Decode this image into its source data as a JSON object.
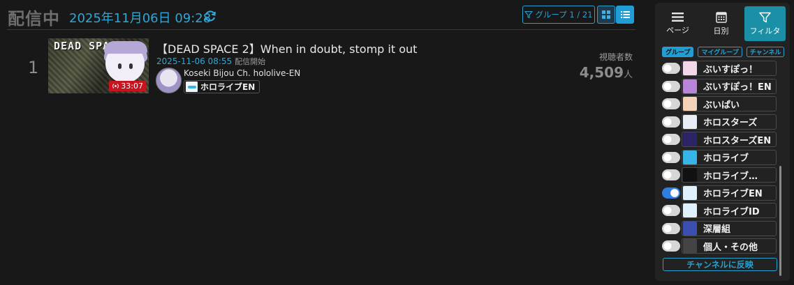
{
  "header": {
    "title": "配信中",
    "datetime": "2025年11月06日 09:28",
    "group_filter_label": "グループ 1 / 21"
  },
  "stream": {
    "rank": "1",
    "title": "【DEAD SPACE 2】When in doubt, stomp it out",
    "start_time": "2025-11-06 08:55",
    "start_label": "配信開始",
    "channel": "Koseki Bijou Ch. hololive-EN",
    "group_tag": "ホロライブEN",
    "duration": "33:07",
    "thumbnail_text": "DEAD SPACE",
    "viewers_label": "視聴者数",
    "viewers": "4,509",
    "viewers_unit": "人"
  },
  "panel": {
    "tabs": [
      {
        "label": "ページ",
        "icon": "hamburger-icon"
      },
      {
        "label": "日別",
        "icon": "calendar-icon"
      },
      {
        "label": "フィルタ",
        "icon": "filter-icon"
      }
    ],
    "subtabs": [
      "グループ",
      "マイグループ",
      "チャンネル"
    ],
    "groups": [
      {
        "label": "ぶいすぽっ！",
        "on": false,
        "color": "#f3d7ea"
      },
      {
        "label": "ぶいすぽっ！EN",
        "on": false,
        "color": "#b985d8"
      },
      {
        "label": "ぶいぱい",
        "on": false,
        "color": "#f5d3b8"
      },
      {
        "label": "ホロスターズ",
        "on": false,
        "color": "#e9eef6"
      },
      {
        "label": "ホロスターズEN",
        "on": false,
        "color": "#2b2466"
      },
      {
        "label": "ホロライブ",
        "on": false,
        "color": "#35b5e8"
      },
      {
        "label": "ホロライブ…",
        "on": false,
        "color": "#111111"
      },
      {
        "label": "ホロライブEN",
        "on": true,
        "color": "#dff2fb"
      },
      {
        "label": "ホロライブID",
        "on": false,
        "color": "#dff2fb"
      },
      {
        "label": "深層組",
        "on": false,
        "color": "#3a4fb0"
      },
      {
        "label": "個人・その他",
        "on": false,
        "color": "#444444"
      }
    ],
    "apply_label": "チャンネルに反映"
  },
  "colors": {
    "accent": "#2ea7d6",
    "filter_tab": "#1b8fa6",
    "live_badge": "#c8141e",
    "toggle_on": "#2f7fe0"
  }
}
